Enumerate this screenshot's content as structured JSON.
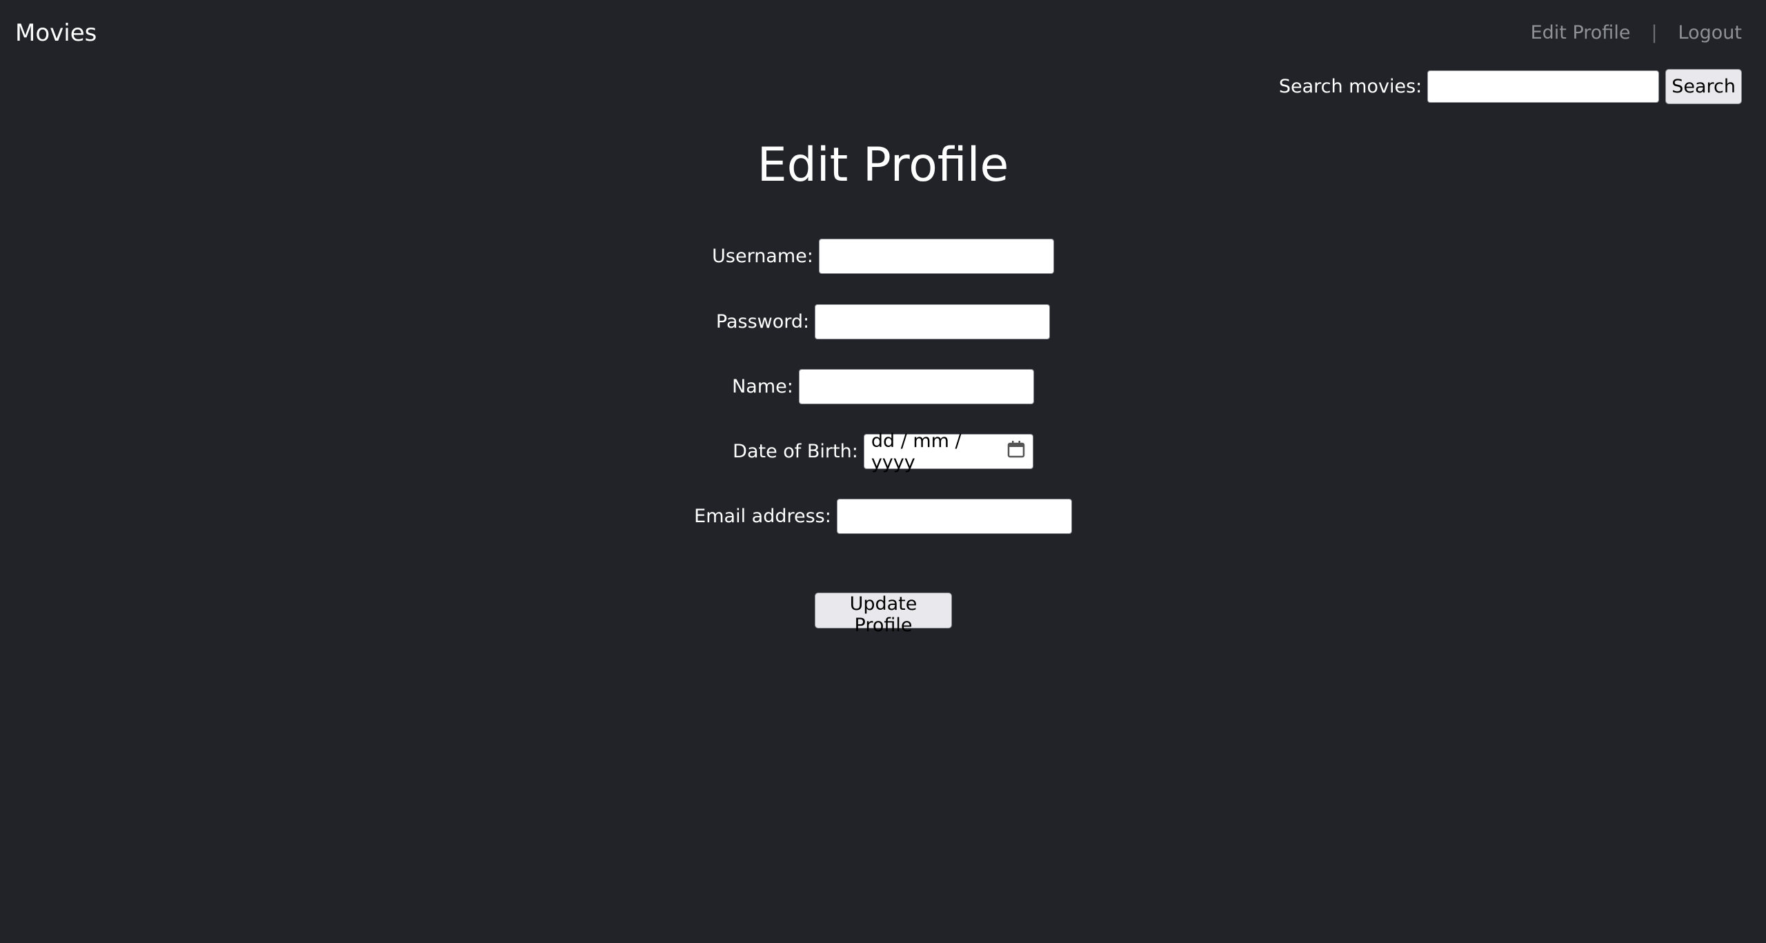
{
  "header": {
    "brand": "Movies",
    "nav": {
      "edit_profile": "Edit Profile",
      "separator": "|",
      "logout": "Logout"
    }
  },
  "search": {
    "label": "Search movies:",
    "value": "",
    "button": "Search"
  },
  "page": {
    "title": "Edit Profile"
  },
  "form": {
    "username_label": "Username:",
    "password_label": "Password:",
    "name_label": "Name:",
    "dob_label": "Date of Birth:",
    "dob_placeholder": "dd / mm / yyyy",
    "email_label": "Email address:",
    "submit": "Update Profile"
  }
}
